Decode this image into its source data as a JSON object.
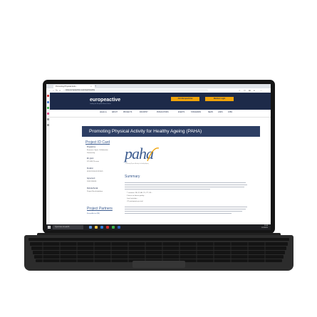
{
  "browser": {
    "tab_title": "Promoting Physical Activ...",
    "tab_close": "×",
    "new_tab": "+",
    "url": "www.europeactive.eu/projects/paha",
    "nav_back": "←",
    "nav_forward": "→",
    "nav_reload": "↻",
    "nav_home": "⌂"
  },
  "site": {
    "logo_text": "europeactive",
    "logo_sub": "Leading the European Fitness Sector",
    "btn_primary": "Join EuropeActive",
    "btn_secondary": "Member Login",
    "menu": [
      "LEGAL &",
      "ABOUT",
      "PROJECTS",
      "INDUSTRY",
      "PUBLICATIONS",
      "EVENTS",
      "STANDARDS",
      "NEWS",
      "LINKS",
      "JOBS"
    ]
  },
  "banner": {
    "title": "Promoting Physical Activity for Healthy Ageing (PAHA)"
  },
  "project_id": {
    "title": "Project ID Card",
    "programme_label": "Programme:",
    "programme_value": "Erasmus+ Sport, Collaborative",
    "programme_value2": "Partnership",
    "budget_label": "EU grant:",
    "budget_value": "370 484,75 euros",
    "duration_label": "Duration:",
    "duration_value": "01/01/2019-31/12/2021",
    "agreement_label": "Agreement:",
    "agreement_value": "2018-3146/01",
    "website_label": "Website/Social:",
    "website_value": "Project Result platform",
    "partners_title": "Project Partners",
    "partners_value": "EuropeActive (BE)"
  },
  "content": {
    "logo_text": "paha",
    "logo_sub": "Promoting Physical Activity for Healthy Ageing",
    "summary_title": "Summary",
    "bullets": [
      "7 countries: DE, FI, AU, PL, PT, UK...",
      "3 focus on fitness quality...",
      "Local activities...",
      "OT participants per trial"
    ]
  },
  "taskbar": {
    "search": "Type here to search",
    "time": "11:35",
    "date": "11/2/2021"
  }
}
